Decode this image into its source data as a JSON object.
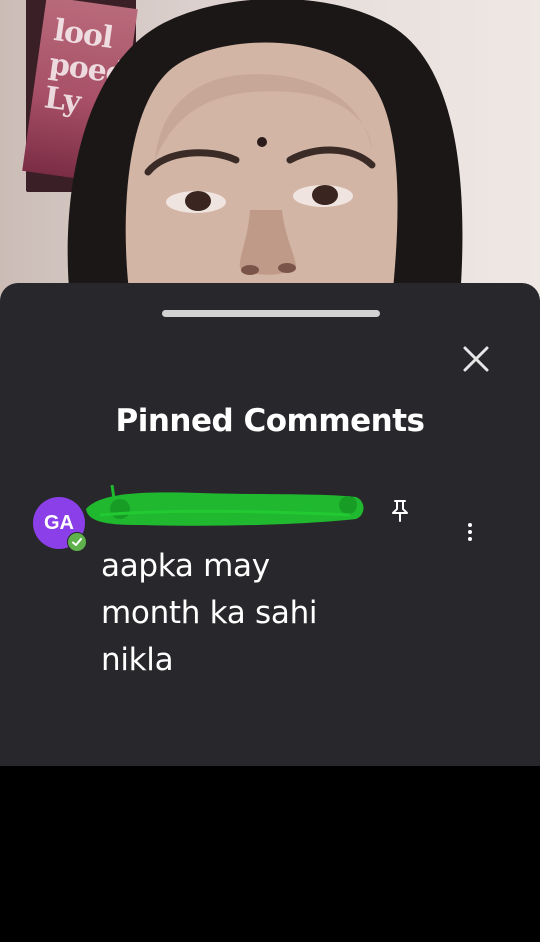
{
  "video": {
    "poster_text": "lool\npoed\nLy"
  },
  "sheet": {
    "title": "Pinned Comments",
    "close_icon": "close-icon",
    "colors": {
      "background": "#28272b",
      "text": "#ffffff",
      "handle": "#d2d2d2"
    }
  },
  "comment": {
    "avatar_initials": "GA",
    "avatar_color": "#8a3fe9",
    "verified_color": "#5fb24b",
    "username_redaction_color": "#1fb82e",
    "text": "aapka may\nmonth ka sahi\nnikla",
    "pin_icon": "pin-icon",
    "more_icon": "more-vertical-icon"
  }
}
